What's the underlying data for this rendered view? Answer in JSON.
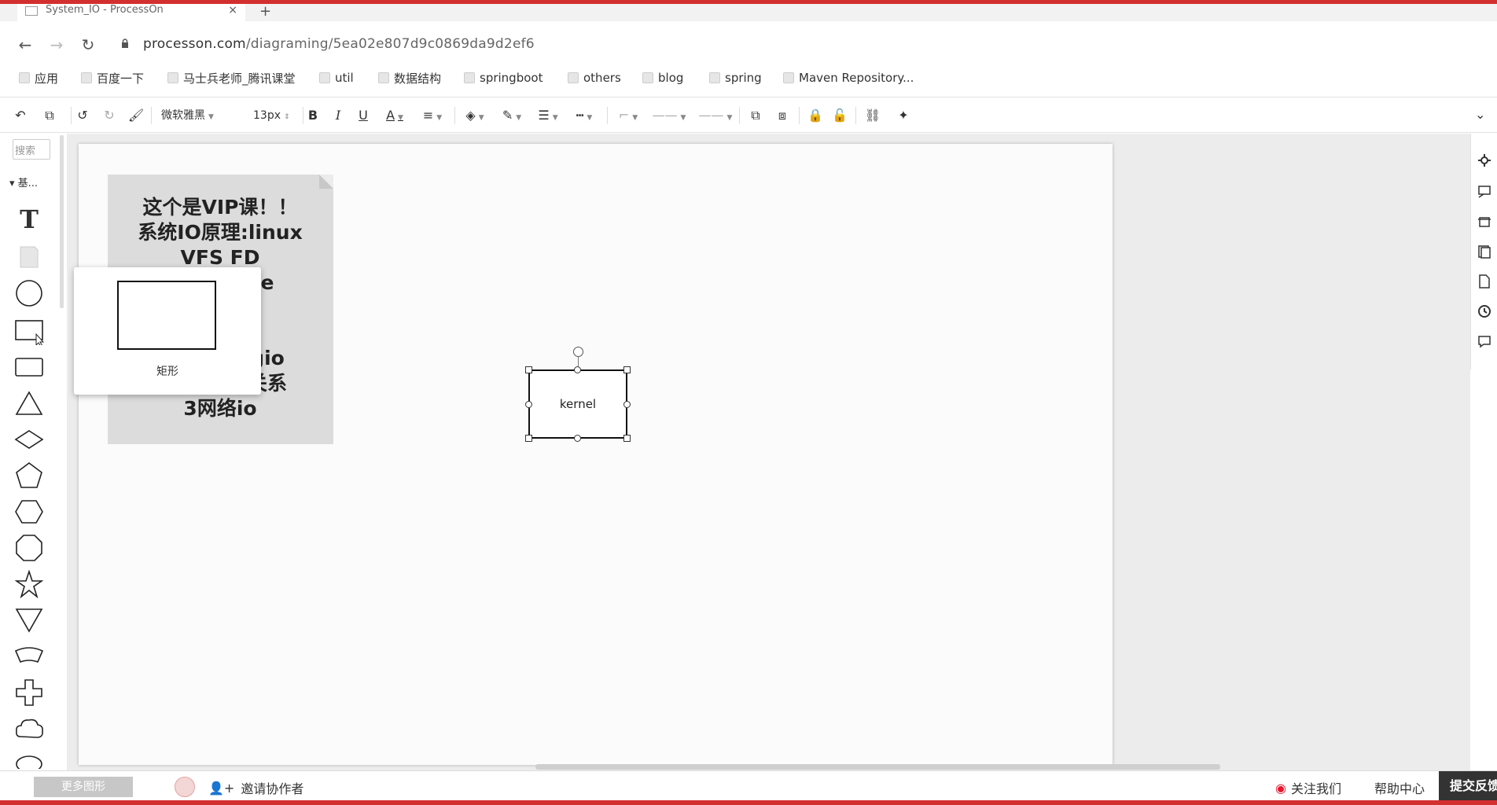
{
  "browser": {
    "tab_title": "System_IO - ProcessOn",
    "tab_close": "×",
    "new_tab": "+",
    "window_title": "",
    "back": "←",
    "forward": "→",
    "reload": "↻",
    "url_host": "processon.com",
    "url_path": "/diagraming/5ea02e807d9c0869da9d2ef6"
  },
  "bookmarks": [
    {
      "label": "应用",
      "icon": "apps-grid-icon"
    },
    {
      "label": "百度一下",
      "icon": "baidu-icon"
    },
    {
      "label": "马士兵老师_腾讯课堂",
      "icon": "tencent-class-icon"
    },
    {
      "label": "util",
      "icon": "folder-icon"
    },
    {
      "label": "数据结构",
      "icon": "folder-icon"
    },
    {
      "label": "springboot",
      "icon": "folder-icon"
    },
    {
      "label": "others",
      "icon": "folder-icon"
    },
    {
      "label": "blog",
      "icon": "folder-icon"
    },
    {
      "label": "spring",
      "icon": "folder-icon"
    },
    {
      "label": "Maven Repository...",
      "icon": "maven-icon"
    }
  ],
  "toolbar": {
    "font_family": "微软雅黑",
    "font_size": "13px",
    "bold": "B",
    "italic": "I",
    "underline": "U",
    "font_color": "A"
  },
  "left_panel": {
    "search_placeholder": "搜索",
    "category": "基...",
    "text_tool": "T"
  },
  "popover": {
    "caption": "矩形"
  },
  "canvas": {
    "note_lines": [
      "这个是VIP课！！",
      "系统IO原理:linux",
      "VFS FD",
      "e",
      "",
      "",
      "gio",
      "关系",
      "3网络io"
    ],
    "kernel_label": "kernel"
  },
  "status": {
    "more_shapes": "更多图形",
    "invite": "邀请协作者",
    "follow": "关注我们",
    "help": "帮助中心",
    "feedback": "提交反馈"
  },
  "colors": {
    "frame": "#d32f2f",
    "note_bg": "#dcdcdc",
    "canvas_bg": "#ececec"
  }
}
